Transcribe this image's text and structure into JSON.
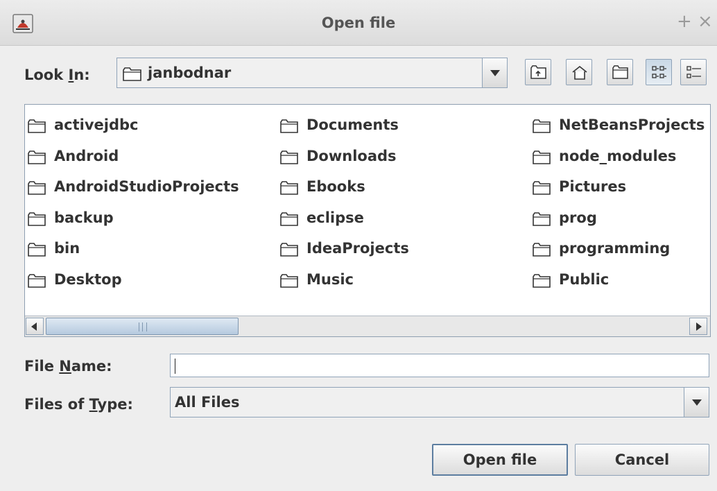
{
  "window": {
    "title": "Open file",
    "buttons": {
      "maximize": "+",
      "close": "×"
    }
  },
  "look_in": {
    "label_prefix": "Look ",
    "label_mnemonic": "I",
    "label_suffix": "n:",
    "value": "janbodnar"
  },
  "toolbar": [
    "up-one-level-icon",
    "home-icon",
    "new-folder-icon",
    "list-view-icon",
    "details-view-icon"
  ],
  "files": [
    {
      "name": "activejdbc"
    },
    {
      "name": "Android"
    },
    {
      "name": "AndroidStudioProjects"
    },
    {
      "name": "backup"
    },
    {
      "name": "bin"
    },
    {
      "name": "Desktop"
    },
    {
      "name": "Documents"
    },
    {
      "name": "Downloads"
    },
    {
      "name": "Ebooks"
    },
    {
      "name": "eclipse"
    },
    {
      "name": "IdeaProjects"
    },
    {
      "name": "Music"
    },
    {
      "name": "NetBeansProjects"
    },
    {
      "name": "node_modules"
    },
    {
      "name": "Pictures"
    },
    {
      "name": "prog"
    },
    {
      "name": "programming"
    },
    {
      "name": "Public"
    }
  ],
  "file_name": {
    "label_prefix": "File ",
    "label_mnemonic": "N",
    "label_suffix": "ame:",
    "value": ""
  },
  "files_of_type": {
    "label_prefix": "Files of ",
    "label_mnemonic": "T",
    "label_suffix": "ype:",
    "value": "All Files"
  },
  "actions": {
    "open": "Open file",
    "cancel": "Cancel"
  },
  "colors": {
    "accent": "#5c7da0",
    "border": "#8fa3b8",
    "background": "#eeeeee"
  }
}
